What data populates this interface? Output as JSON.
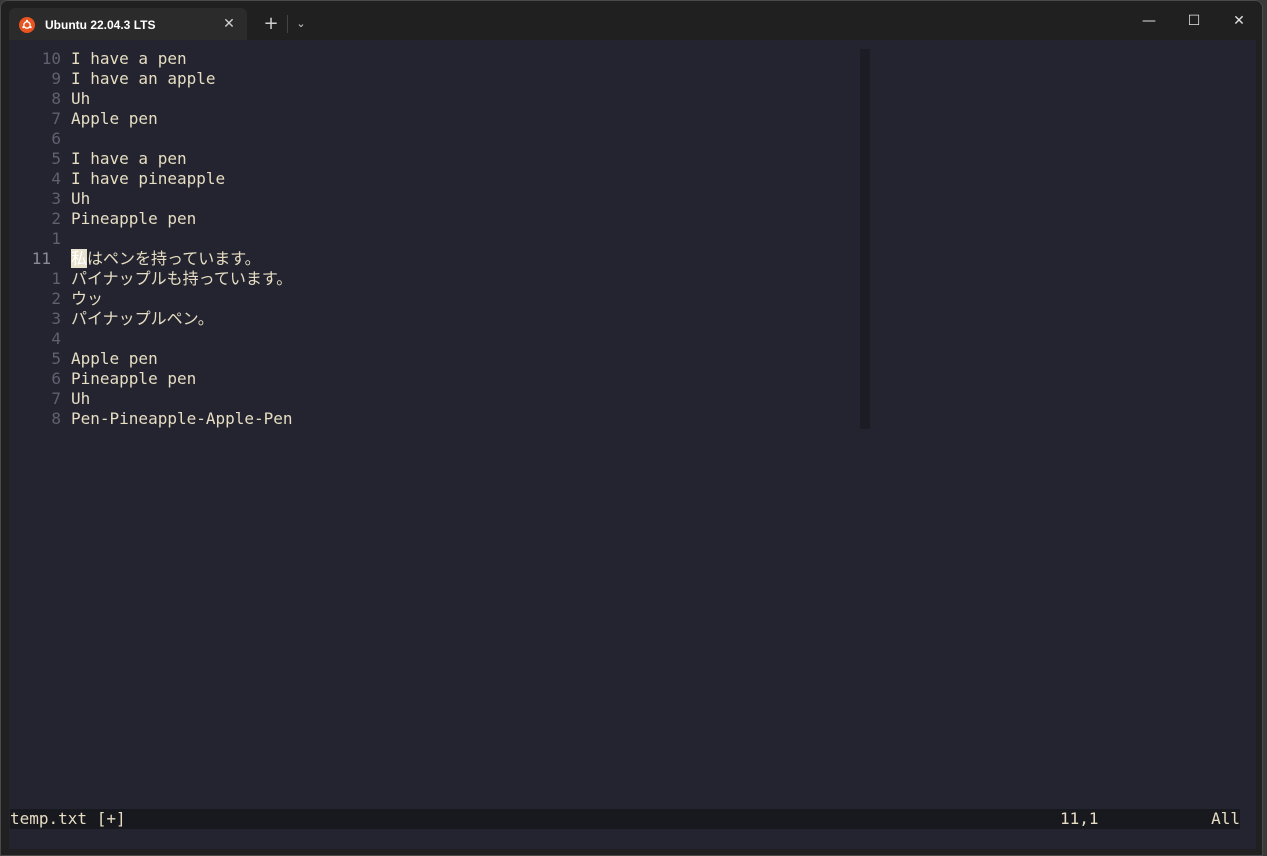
{
  "window": {
    "tab_title": "Ubuntu 22.04.3 LTS",
    "tab_close": "✕",
    "new_tab": "+",
    "tab_menu": "⌄",
    "minimize": "—",
    "maximize": "☐",
    "close": "✕"
  },
  "editor": {
    "lines": [
      {
        "num": "10",
        "text": "I have a pen"
      },
      {
        "num": "9",
        "text": "I have an apple"
      },
      {
        "num": "8",
        "text": "Uh"
      },
      {
        "num": "7",
        "text": "Apple pen"
      },
      {
        "num": "6",
        "text": ""
      },
      {
        "num": "5",
        "text": "I have a pen"
      },
      {
        "num": "4",
        "text": "I have pineapple"
      },
      {
        "num": "3",
        "text": "Uh"
      },
      {
        "num": "2",
        "text": "Pineapple pen"
      },
      {
        "num": "1",
        "text": ""
      },
      {
        "num": "11",
        "cursor_char": "私",
        "text": "はペンを持っています。",
        "current": true
      },
      {
        "num": "1",
        "text": "パイナップルも持っています。"
      },
      {
        "num": "2",
        "text": "ウッ"
      },
      {
        "num": "3",
        "text": "パイナップルペン。"
      },
      {
        "num": "4",
        "text": ""
      },
      {
        "num": "5",
        "text": "Apple pen"
      },
      {
        "num": "6",
        "text": "Pineapple pen"
      },
      {
        "num": "7",
        "text": "Uh"
      },
      {
        "num": "8",
        "text": "Pen-Pineapple-Apple-Pen"
      }
    ]
  },
  "status": {
    "file": "temp.txt [+]",
    "position": "11,1",
    "scroll": "All"
  },
  "colors": {
    "background": "#23242f",
    "text": "#e6ddc2",
    "line_number": "#5f6070",
    "accent": "#e95420"
  }
}
